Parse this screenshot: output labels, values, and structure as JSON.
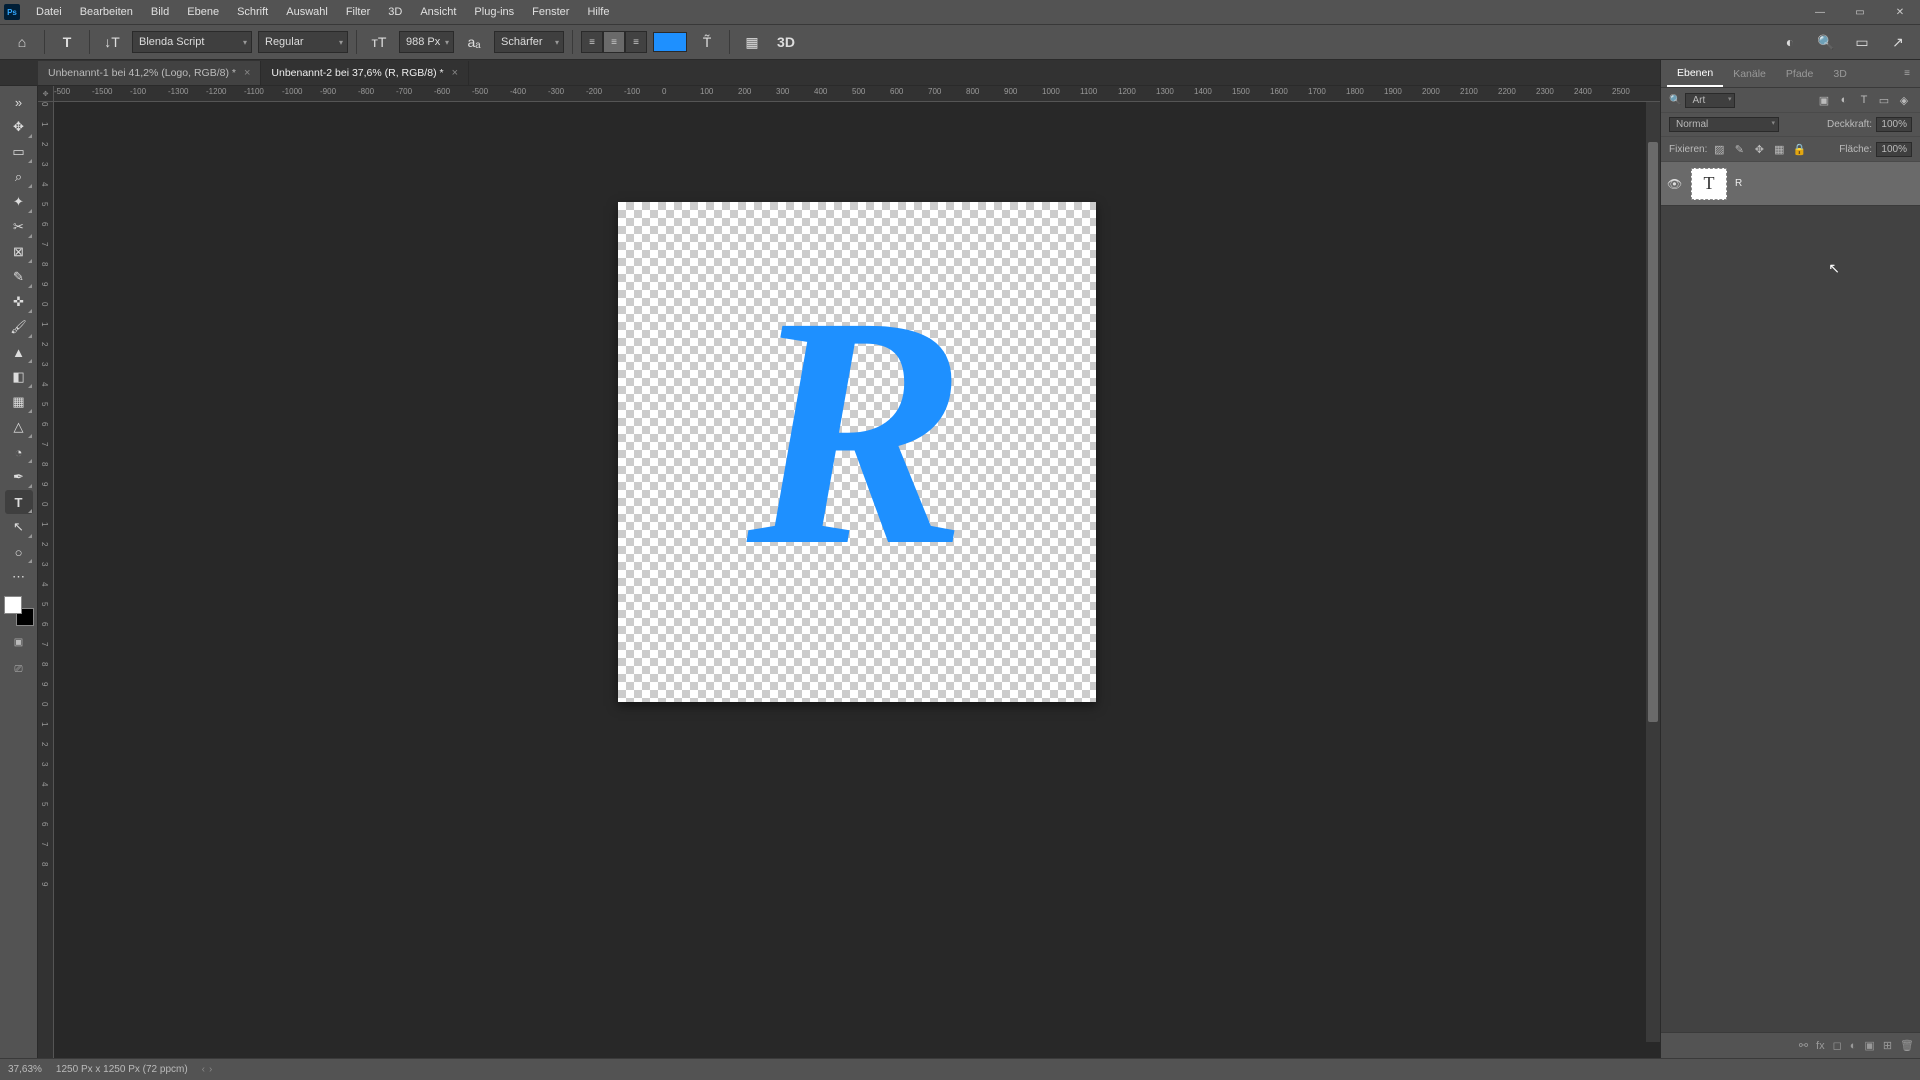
{
  "menu": {
    "items": [
      "Datei",
      "Bearbeiten",
      "Bild",
      "Ebene",
      "Schrift",
      "Auswahl",
      "Filter",
      "3D",
      "Ansicht",
      "Plug-ins",
      "Fenster",
      "Hilfe"
    ]
  },
  "options": {
    "font_family": "Blenda Script",
    "font_style": "Regular",
    "font_size": "988 Px",
    "antialias": "Schärfer",
    "text_color": "#1e90ff",
    "threed_label": "3D"
  },
  "tabs": [
    {
      "label": "Unbenannt-1 bei 41,2% (Logo, RGB/8) *",
      "active": false
    },
    {
      "label": "Unbenannt-2 bei 37,6% (R, RGB/8) *",
      "active": true
    }
  ],
  "ruler_h": [
    "-500",
    "-1500",
    "-100",
    "-1300",
    "-1200",
    "-1100",
    "-1000",
    "-900",
    "-800",
    "-700",
    "-600",
    "-500",
    "-400",
    "-300",
    "-200",
    "-100",
    "0",
    "100",
    "200",
    "300",
    "400",
    "500",
    "600",
    "700",
    "800",
    "900",
    "1000",
    "1100",
    "1200",
    "1300",
    "1400",
    "1500",
    "1600",
    "1700",
    "1800",
    "1900",
    "2000",
    "2100",
    "2200",
    "2300",
    "2400",
    "2500"
  ],
  "ruler_v_ticks": [
    "0",
    "1",
    "2",
    "3",
    "4",
    "5",
    "6",
    "7",
    "8",
    "9",
    "0",
    "1",
    "2",
    "3",
    "4",
    "5"
  ],
  "canvas": {
    "letter": "R"
  },
  "panels": {
    "tabs": [
      "Ebenen",
      "Kanäle",
      "Pfade",
      "3D"
    ],
    "filter_label": "Art",
    "blend_mode": "Normal",
    "opacity_label": "Deckkraft:",
    "opacity_value": "100%",
    "lock_label": "Fixieren:",
    "fill_label": "Fläche:",
    "fill_value": "100%",
    "layers": [
      {
        "name": "R",
        "thumb": "T"
      }
    ]
  },
  "status": {
    "zoom": "37,63%",
    "doc_info": "1250 Px x 1250 Px (72 ppcm)"
  }
}
